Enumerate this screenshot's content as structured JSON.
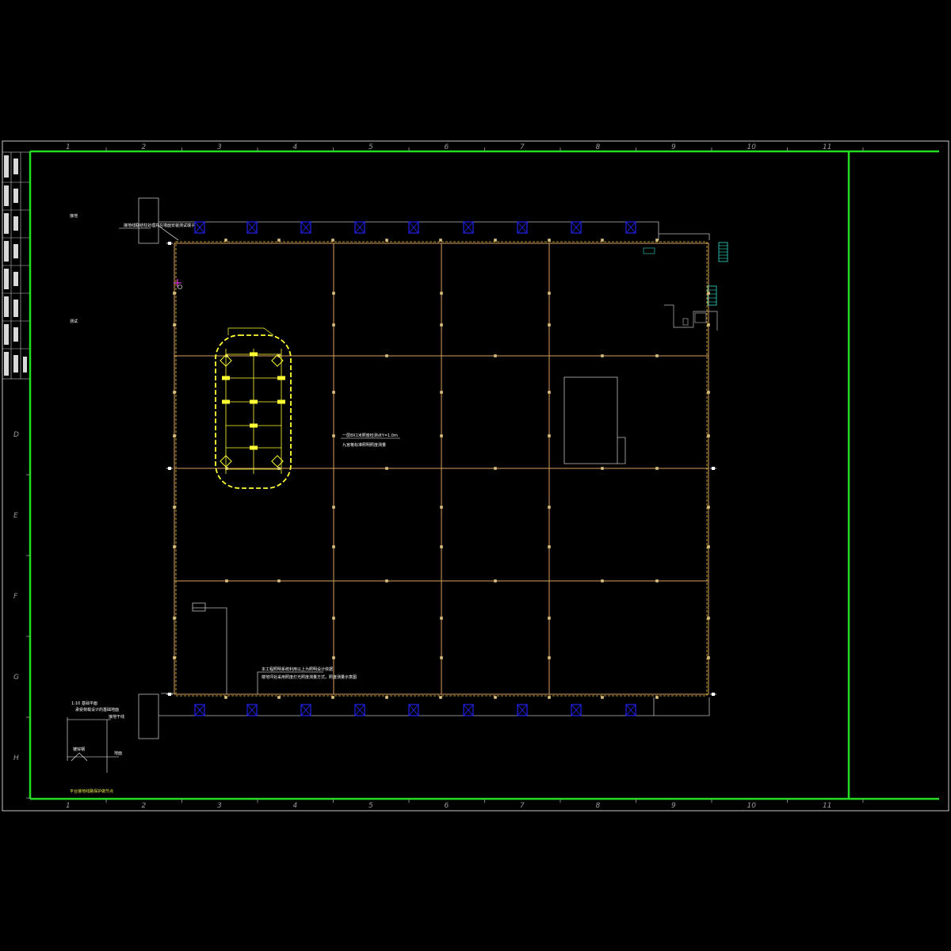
{
  "sheet": {
    "column_labels": [
      "1",
      "2",
      "3",
      "4",
      "5",
      "6",
      "7",
      "8",
      "9",
      "10",
      "11"
    ],
    "row_labels": [
      "D",
      "E",
      "F",
      "G",
      "H"
    ]
  },
  "colors": {
    "background": "#000000",
    "frame_green": "#22dd22",
    "sheet_border": "#c8c8c8",
    "grid_orange": "#d9a060",
    "wall_gray": "#bcbcbc",
    "window_blue": "#2222ee",
    "zone_yellow": "#ffff33",
    "stair_cyan": "#33ddcc",
    "text_white": "#ffffff"
  },
  "notes": {
    "center_note_1": "一层8X1米照度检测点Y=1.0m",
    "center_note_2": "九宫格标准照明照度测量",
    "bottom_note_1": "本工程照明系统利用以上为照明设计依据",
    "bottom_note_2": "楼地坪处采用照度灯光照度测量方式，照度测量示意图",
    "detail_note_1": "1:10 基础平面",
    "detail_note_2": "承受荷载设计的基础地面",
    "detail_note_3": "接地干线",
    "detail_note_4": "镀锌钢",
    "detail_note_5": "地面",
    "detail_title": "平台接地线路保护做节点",
    "top_left_callout": "接地线联结柱处理并在墙面安装测试端子",
    "side_mark_1": "接地",
    "side_mark_2": "测试"
  },
  "icons": [
    "window-x-symbol",
    "grounding-test-point",
    "stair-symbol",
    "lighting-fixture-symbol"
  ]
}
